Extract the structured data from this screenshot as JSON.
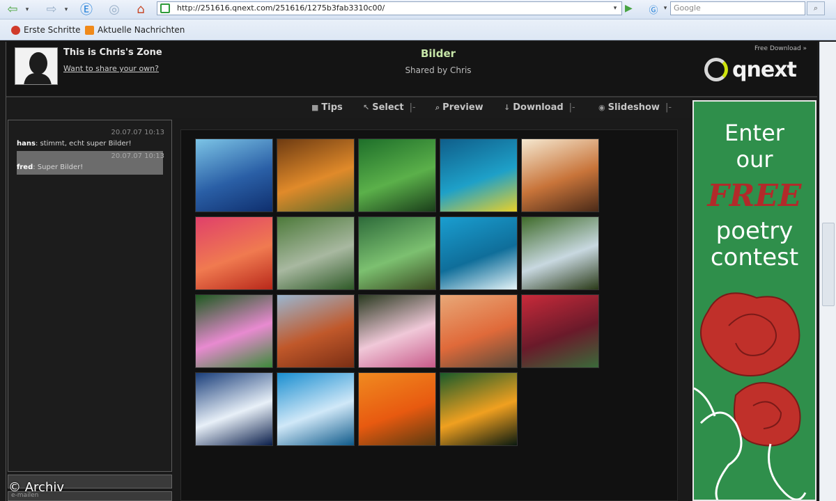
{
  "browser": {
    "url": "http://251616.qnext.com/251616/1275b3fab3310c00/",
    "search_placeholder": "Google",
    "bookmarks": [
      {
        "label": "Erste Schritte"
      },
      {
        "label": "Aktuelle Nachrichten"
      }
    ]
  },
  "header": {
    "zone_title": "This is Chris's Zone",
    "share_link": "Want to share your own?",
    "page_title": "Bilder",
    "page_subtitle": "Shared by Chris",
    "free_download": "Free Download »",
    "logo_text": "qnext"
  },
  "actions": [
    {
      "label": "Tips",
      "icon": "chat-icon"
    },
    {
      "label": "Select",
      "icon": "cursor-icon",
      "dropdown": "|-"
    },
    {
      "label": "Preview",
      "icon": "magnifier-icon"
    },
    {
      "label": "Download",
      "icon": "download-arrow-icon",
      "dropdown": "|-"
    },
    {
      "label": "Slideshow",
      "icon": "play-circle-icon",
      "dropdown": "|-"
    }
  ],
  "chat": {
    "messages": [
      {
        "time": "20.07.07 10:13",
        "user": "hans",
        "text": ": stimmt, echt super Bilder!"
      },
      {
        "time": "20.07.07 10:13",
        "user": "fred",
        "text": ": Super Bilder!"
      }
    ],
    "input_hint": "e-mailen"
  },
  "gallery": {
    "thumbnails": [
      {
        "name": "blue-mountains",
        "colors": [
          "#7cc4e6",
          "#2a5fa6",
          "#0f2f6e"
        ]
      },
      {
        "name": "autumn-tree",
        "colors": [
          "#6e3b12",
          "#e08a2a",
          "#5c6b2a"
        ]
      },
      {
        "name": "green-leaves",
        "colors": [
          "#1e6f2a",
          "#5bb04a",
          "#1a3e1a"
        ]
      },
      {
        "name": "sea-turtle",
        "colors": [
          "#0f5e8a",
          "#1ea0c8",
          "#e8d02a"
        ]
      },
      {
        "name": "savanna-sunset",
        "colors": [
          "#f5e8d0",
          "#c8743a",
          "#4a2a18"
        ]
      },
      {
        "name": "pink-sunset",
        "colors": [
          "#e0406a",
          "#f07a50",
          "#b8281a"
        ]
      },
      {
        "name": "river-meadow",
        "colors": [
          "#4d7a3a",
          "#a8b8a0",
          "#2f5a28"
        ]
      },
      {
        "name": "forest-path",
        "colors": [
          "#2d6b3a",
          "#7cc070",
          "#3a4a20"
        ]
      },
      {
        "name": "whale-tail",
        "colors": [
          "#1a9ed0",
          "#0f6e9a",
          "#e6f4f8"
        ]
      },
      {
        "name": "waterfall",
        "colors": [
          "#3f6b2a",
          "#c8d8e0",
          "#2a3a18"
        ]
      },
      {
        "name": "water-lilies",
        "colors": [
          "#1e5a20",
          "#e88ad0",
          "#3c8a3a"
        ]
      },
      {
        "name": "monument-valley",
        "colors": [
          "#9ab6d0",
          "#c0582a",
          "#7a2e14"
        ]
      },
      {
        "name": "plumeria",
        "colors": [
          "#2a3a20",
          "#f0c8d8",
          "#c85a8a"
        ]
      },
      {
        "name": "desert-dunes",
        "colors": [
          "#e8a878",
          "#e06a3a",
          "#5a4a3a"
        ]
      },
      {
        "name": "red-leaves",
        "colors": [
          "#c82a3a",
          "#6a1a2a",
          "#3a6a3a"
        ]
      },
      {
        "name": "ocean-wave",
        "colors": [
          "#1a3e7a",
          "#e8f0f8",
          "#0a1e4a"
        ]
      },
      {
        "name": "iceberg",
        "colors": [
          "#1a8ed0",
          "#d0e8f8",
          "#0f5a8a"
        ]
      },
      {
        "name": "orange-flowers",
        "colors": [
          "#f08a20",
          "#e85a10",
          "#5a3a10"
        ]
      },
      {
        "name": "toucan",
        "colors": [
          "#1a5a2a",
          "#f0a020",
          "#0a1a10"
        ]
      }
    ]
  },
  "ad": {
    "line1": "Enter",
    "line2": "our",
    "free": "FREE",
    "line3": "poetry",
    "line4": "contest",
    "colors": {
      "background": "#2f8f4b",
      "rose": "#c0302a"
    }
  },
  "watermark": "© Archiv"
}
